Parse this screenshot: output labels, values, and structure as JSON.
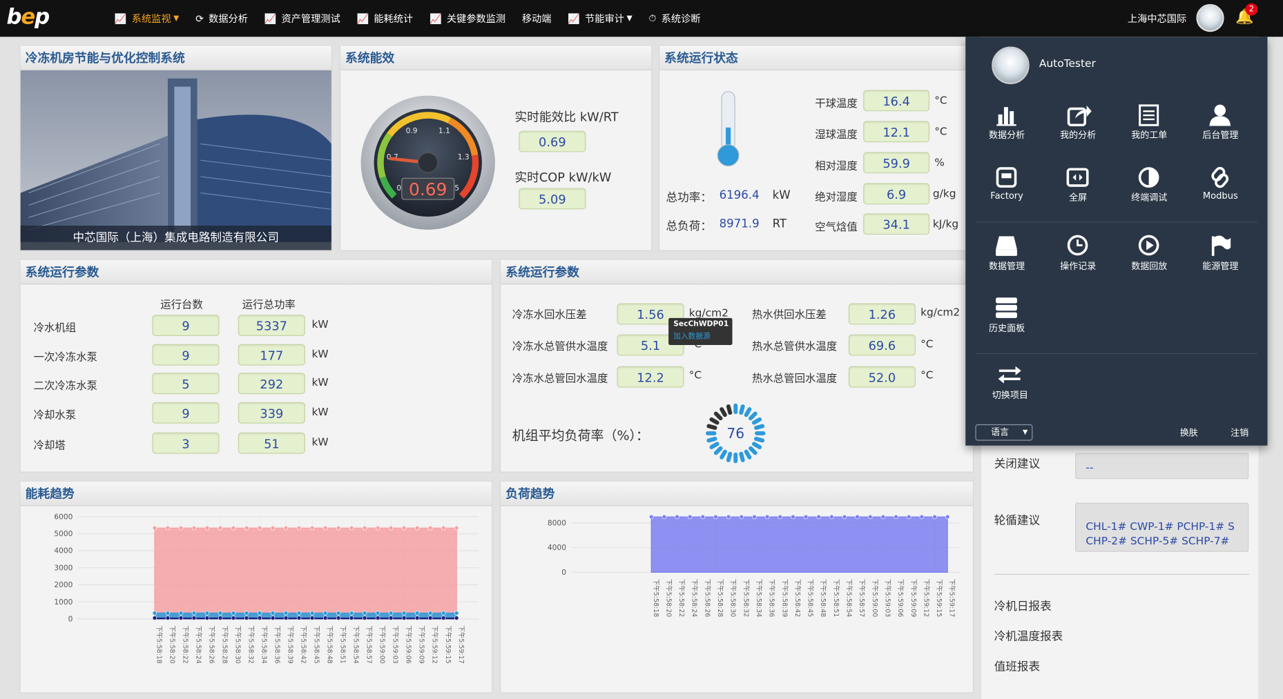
{
  "nav": {
    "logo_prefix": "b",
    "logo_e": "e",
    "logo_suffix": "p",
    "items": [
      {
        "label": "系统监视",
        "icon": "line-chart-icon"
      },
      {
        "label": "数据分析",
        "icon": "refresh-icon"
      },
      {
        "label": "资产管理测试",
        "icon": "line-chart-icon"
      },
      {
        "label": "能耗统计",
        "icon": "line-chart-icon"
      },
      {
        "label": "关键参数监测",
        "icon": "line-chart-icon"
      },
      {
        "label": "移动端",
        "icon": ""
      },
      {
        "label": "节能审计",
        "icon": "line-chart-icon"
      },
      {
        "label": "系统诊断",
        "icon": "clock-icon"
      }
    ],
    "company": "上海中芯国际",
    "notification_count": "2"
  },
  "photo_panel": {
    "title": "冷冻机房节能与优化控制系统",
    "caption": "中芯国际（上海）集成电路制造有限公司"
  },
  "efficiency": {
    "title": "系统能效",
    "gauge_value": "0.69",
    "gauge_ticks": [
      "0.5",
      "0.7",
      "0.9",
      "1.1",
      "1.3",
      "1.5"
    ],
    "kw_rt_label": "实时能效比 kW/RT",
    "kw_rt_value": "0.69",
    "cop_label": "实时COP  kW/kW",
    "cop_value": "5.09",
    "needle_value": 0.69,
    "gauge_min": 0.5,
    "gauge_max": 1.5
  },
  "status": {
    "title": "系统运行状态",
    "total_power_label": "总功率：",
    "total_power_value": "6196.4",
    "total_power_unit": "kW",
    "total_load_label": "总负荷：",
    "total_load_value": "8971.9",
    "total_load_unit": "RT",
    "rows": [
      {
        "label": "干球温度",
        "value": "16.4",
        "unit": "°C"
      },
      {
        "label": "湿球温度",
        "value": "12.1",
        "unit": "°C"
      },
      {
        "label": "相对湿度",
        "value": "59.9",
        "unit": "%"
      },
      {
        "label": "绝对湿度",
        "value": "6.9",
        "unit": "g/kg"
      },
      {
        "label": "空气焓值",
        "value": "34.1",
        "unit": "kJ/kg"
      }
    ]
  },
  "params_left": {
    "title": "系统运行参数",
    "col1": "运行台数",
    "col2": "运行总功率",
    "rows": [
      {
        "label": "冷水机组",
        "count": "9",
        "power": "5337",
        "unit": "kW"
      },
      {
        "label": "一次冷冻水泵",
        "count": "9",
        "power": "177",
        "unit": "kW"
      },
      {
        "label": "二次冷冻水泵",
        "count": "5",
        "power": "292",
        "unit": "kW"
      },
      {
        "label": "冷却水泵",
        "count": "9",
        "power": "339",
        "unit": "kW"
      },
      {
        "label": "冷却塔",
        "count": "3",
        "power": "51",
        "unit": "kW"
      }
    ]
  },
  "params_right": {
    "title": "系统运行参数",
    "left": [
      {
        "label": "冷冻水回水压差",
        "value": "1.56",
        "unit": "kg/cm2"
      },
      {
        "label": "冷冻水总管供水温度",
        "value": "5.1",
        "unit": "°C"
      },
      {
        "label": "冷冻水总管回水温度",
        "value": "12.2",
        "unit": "°C"
      }
    ],
    "right": [
      {
        "label": "热水供回水压差",
        "value": "1.26",
        "unit": "kg/cm2"
      },
      {
        "label": "热水总管供水温度",
        "value": "69.6",
        "unit": "°C"
      },
      {
        "label": "热水总管回水温度",
        "value": "52.0",
        "unit": "°C"
      }
    ],
    "load_rate_label": "机组平均负荷率（%）：",
    "load_rate_value": "76"
  },
  "tooltip": {
    "title": "SecChWDP01",
    "sub": "加入数据源"
  },
  "right_col": {
    "close_label": "关闭建议",
    "close_value": "--",
    "rotate_label": "轮循建议",
    "rotate_value": "CHL-1# CWP-1# PCHP-1# SCHP-2# SCHP-5# SCHP-7#",
    "links": [
      "冷机日报表",
      "冷机温度报表",
      "值班报表"
    ]
  },
  "dropdown": {
    "username": "AutoTester",
    "items": [
      {
        "label": "数据分析",
        "icon": "bar-chart-icon"
      },
      {
        "label": "我的分析",
        "icon": "share-icon"
      },
      {
        "label": "我的工单",
        "icon": "list-icon"
      },
      {
        "label": "后台管理",
        "icon": "user-icon"
      },
      {
        "label": "Factory",
        "icon": "factory-icon"
      },
      {
        "label": "全屏",
        "icon": "fullscreen-icon"
      },
      {
        "label": "终端调试",
        "icon": "contrast-icon"
      },
      {
        "label": "Modbus",
        "icon": "link-icon"
      },
      {
        "label": "数据管理",
        "icon": "drive-icon"
      },
      {
        "label": "操作记录",
        "icon": "clock-icon"
      },
      {
        "label": "数据回放",
        "icon": "play-icon"
      },
      {
        "label": "能源管理",
        "icon": "flag-icon"
      },
      {
        "label": "历史面板",
        "icon": "server-icon"
      },
      {
        "label": "切换项目",
        "icon": "switch-icon"
      }
    ],
    "language": "语言",
    "skin": "换肤",
    "logout": "注销"
  },
  "chart_data": [
    {
      "type": "area",
      "title": "能耗趋势",
      "yticks": [
        "6000",
        "5000",
        "4000",
        "3000",
        "2000",
        "1000",
        "0"
      ],
      "ylim": [
        0,
        6000
      ],
      "x": [
        "下午5:58:18",
        "下午5:58:20",
        "下午5:58:22",
        "下午5:58:24",
        "下午5:58:26",
        "下午5:58:28",
        "下午5:58:30",
        "下午5:58:32",
        "下午5:58:34",
        "下午5:58:36",
        "下午5:58:39",
        "下午5:58:42",
        "下午5:58:45",
        "下午5:58:48",
        "下午5:58:51",
        "下午5:58:54",
        "下午5:58:57",
        "下午5:59:00",
        "下午5:59:03",
        "下午5:59:06",
        "下午5:59:09",
        "下午5:59:12",
        "下午5:59:15",
        "下午5:59:17"
      ],
      "series": [
        {
          "color": "#f5a0a2",
          "values": [
            5337,
            5337,
            5337,
            5337,
            5337,
            5337,
            5337,
            5337,
            5337,
            5337,
            5337,
            5337,
            5337,
            5337,
            5337,
            5337,
            5337,
            5337,
            5337,
            5337,
            5337,
            5337,
            5337,
            5337
          ]
        },
        {
          "color": "#2e9ad9",
          "values": [
            339,
            339,
            339,
            339,
            339,
            339,
            339,
            339,
            339,
            339,
            339,
            339,
            339,
            339,
            339,
            339,
            339,
            339,
            339,
            339,
            339,
            339,
            339,
            339
          ]
        },
        {
          "color": "#1a237e",
          "values": [
            51,
            51,
            51,
            51,
            51,
            51,
            51,
            51,
            51,
            51,
            51,
            51,
            51,
            51,
            51,
            51,
            51,
            51,
            51,
            51,
            51,
            51,
            51,
            51
          ]
        }
      ]
    },
    {
      "type": "area",
      "title": "负荷趋势",
      "yticks": [
        "8000",
        "4000",
        "0"
      ],
      "ylim": [
        0,
        9000
      ],
      "x": [
        "下午5:58:18",
        "下午5:58:20",
        "下午5:58:22",
        "下午5:58:24",
        "下午5:58:26",
        "下午5:58:28",
        "下午5:58:30",
        "下午5:58:32",
        "下午5:58:34",
        "下午5:58:36",
        "下午5:58:39",
        "下午5:58:42",
        "下午5:58:45",
        "下午5:58:48",
        "下午5:58:51",
        "下午5:58:54",
        "下午5:58:57",
        "下午5:59:00",
        "下午5:59:03",
        "下午5:59:06",
        "下午5:59:09",
        "下午5:59:12",
        "下午5:59:15",
        "下午5:59:17"
      ],
      "series": [
        {
          "color": "#7b7ff0",
          "values": [
            8972,
            8972,
            8972,
            8972,
            8972,
            8972,
            8972,
            8972,
            8972,
            8972,
            8972,
            8972,
            8972,
            8972,
            8972,
            8972,
            8972,
            8972,
            8972,
            8972,
            8972,
            8972,
            8972,
            8972
          ]
        }
      ]
    }
  ]
}
